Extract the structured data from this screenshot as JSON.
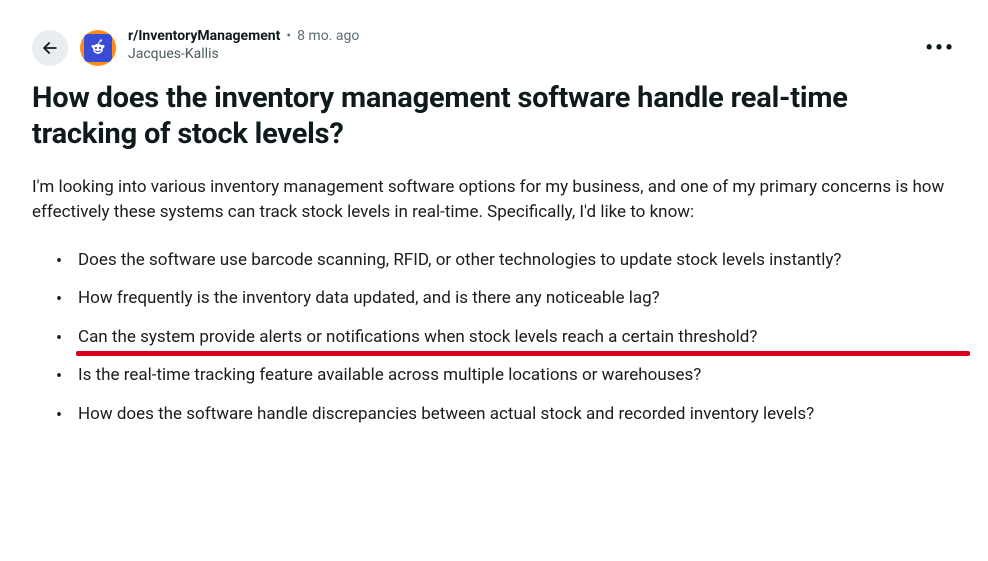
{
  "header": {
    "subreddit": "r/InventoryManagement",
    "separator": "•",
    "time_ago": "8 mo. ago",
    "author": "Jacques-Kallis"
  },
  "post": {
    "title": "How does the inventory management software handle real-time tracking of stock levels?",
    "intro": "I'm looking into various inventory management software options for my business, and one of my primary concerns is how effectively these systems can track stock levels in real-time. Specifically, I'd like to know:",
    "bullets": [
      "Does the software use barcode scanning, RFID, or other technologies to update stock levels instantly?",
      "How frequently is the inventory data updated, and is there any noticeable lag?",
      "Can the system provide alerts or notifications when stock levels reach a certain threshold?",
      "Is the real-time tracking feature available across multiple locations or warehouses?",
      "How does the software handle discrepancies between actual stock and recorded inventory levels?"
    ]
  },
  "annotation": {
    "highlighted_bullet_index": 2
  }
}
